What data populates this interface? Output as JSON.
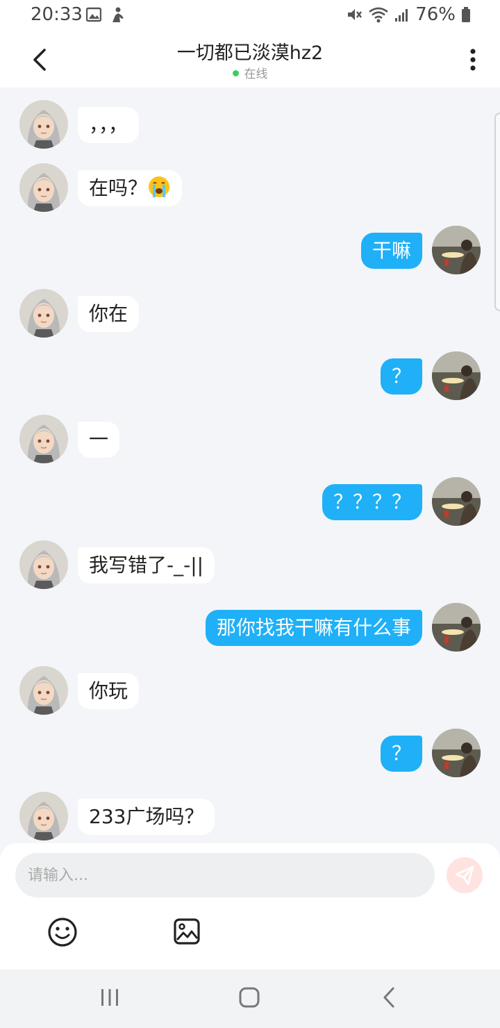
{
  "status_bar": {
    "time": "20:33",
    "battery": "76%",
    "icons": [
      "image-icon",
      "figure-icon",
      "mute-icon",
      "wifi-icon",
      "signal-icon",
      "battery-icon"
    ]
  },
  "header": {
    "title": "一切都已淡漠hz2",
    "status": "在线",
    "status_color": "#3ccf5b",
    "back_icon": "chevron-left-icon",
    "more_icon": "more-vertical-icon"
  },
  "messages": [
    {
      "side": "left",
      "text": "，，，"
    },
    {
      "side": "left",
      "text": "在吗？",
      "emoji": "crying-face"
    },
    {
      "side": "right",
      "text": "干嘛"
    },
    {
      "side": "left",
      "text": "你在"
    },
    {
      "side": "right",
      "text": "？"
    },
    {
      "side": "left",
      "text": "一"
    },
    {
      "side": "right",
      "text": "？？？？"
    },
    {
      "side": "left",
      "text": "我写错了-_-||"
    },
    {
      "side": "right",
      "text": "那你找我干嘛有什么事"
    },
    {
      "side": "left",
      "text": "你玩"
    },
    {
      "side": "right",
      "text": "？"
    },
    {
      "side": "left",
      "text": "233广场吗？"
    }
  ],
  "input": {
    "placeholder": "请输入...",
    "value": "",
    "send_icon": "send-icon",
    "tools": [
      "emoji-icon",
      "image-icon"
    ]
  },
  "colors": {
    "accent": "#1fb0f7",
    "background": "#f3f5f8",
    "send_button": "#ffe3e0"
  },
  "nav": [
    "recents-icon",
    "home-icon",
    "back-icon"
  ]
}
